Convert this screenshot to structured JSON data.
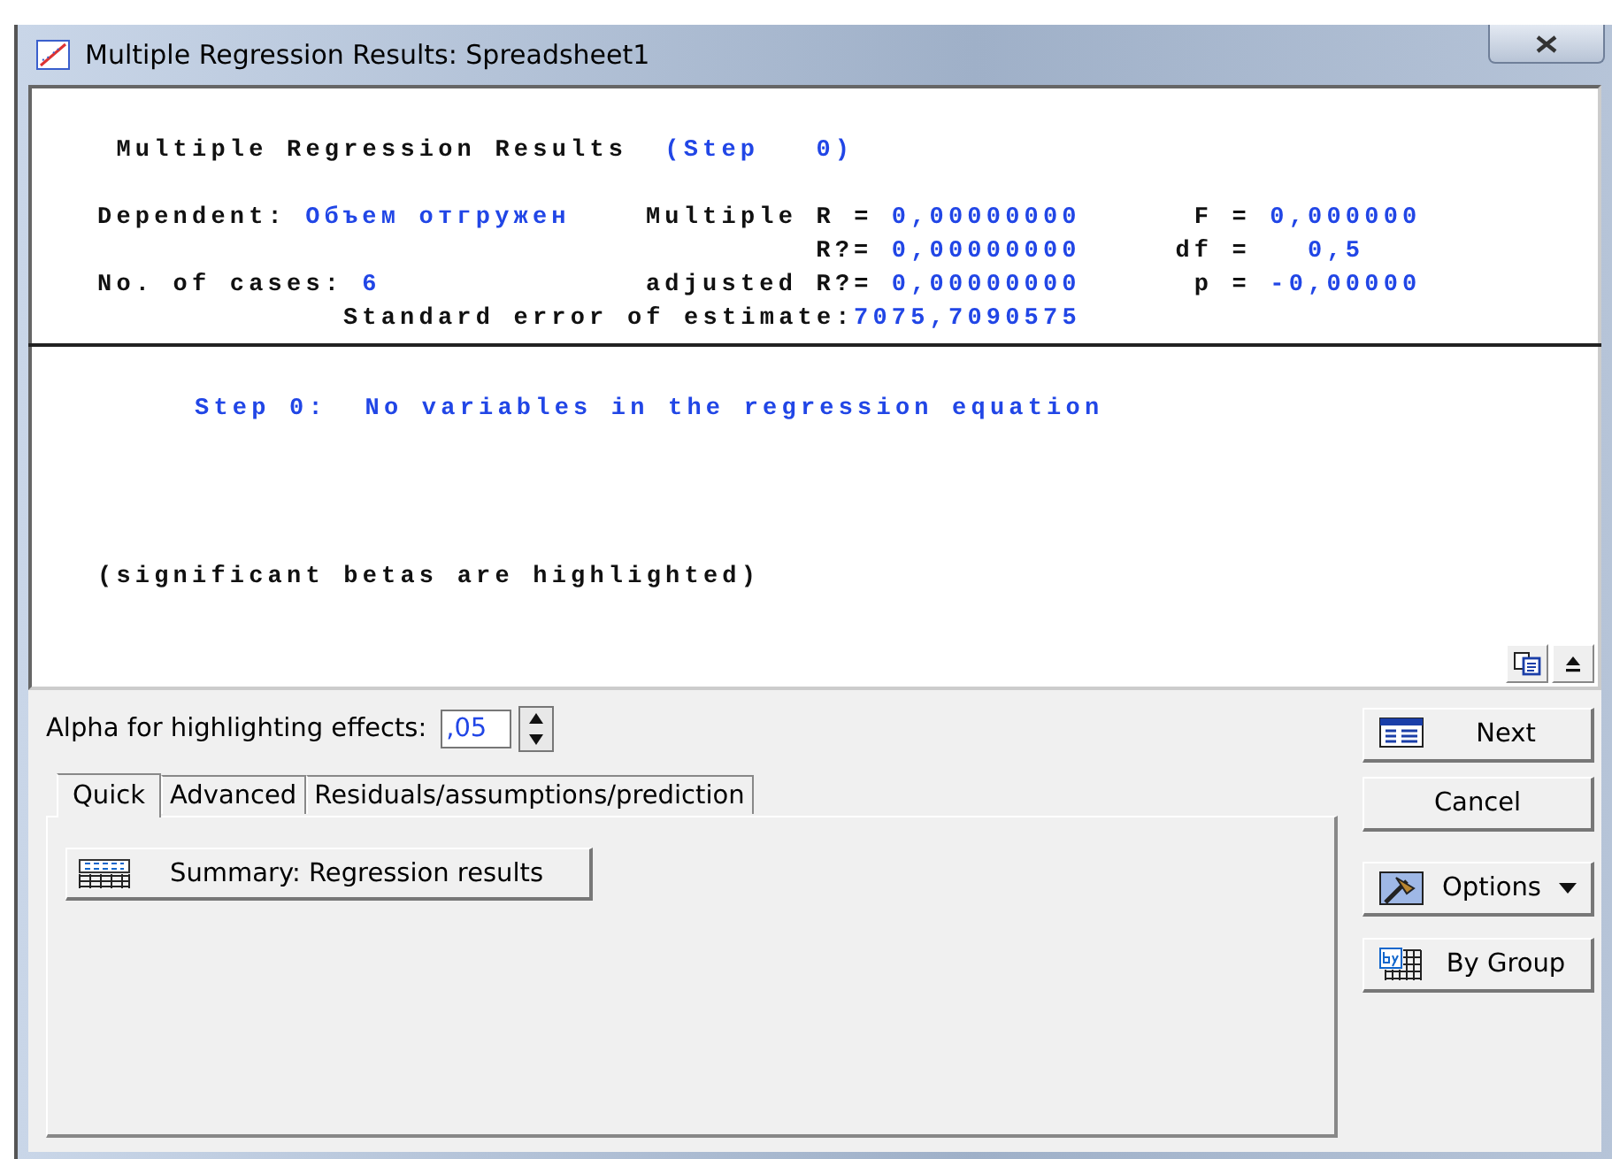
{
  "window": {
    "title": "Multiple Regression Results: Spreadsheet1"
  },
  "results": {
    "lines": [
      {
        "kind": "header",
        "segments": [
          {
            "text": "Multiple Regression Results",
            "highlight": false
          },
          {
            "text": "(Step   0)",
            "highlight": true
          }
        ]
      },
      {
        "kind": "dependent",
        "segments": [
          {
            "text": "Dependent:",
            "highlight": false
          },
          {
            "text": "Объем отгружен",
            "highlight": true
          },
          {
            "text": "Multiple R =",
            "highlight": false
          },
          {
            "text": "0,00000000",
            "highlight": true
          },
          {
            "text": "F =",
            "highlight": false
          },
          {
            "text": "0,000000",
            "highlight": true
          }
        ]
      },
      {
        "kind": "r2",
        "segments": [
          {
            "text": "R?=",
            "highlight": false
          },
          {
            "text": "0,00000000",
            "highlight": true
          },
          {
            "text": "df =",
            "highlight": false
          },
          {
            "text": "0,5",
            "highlight": true
          }
        ]
      },
      {
        "kind": "cases",
        "segments": [
          {
            "text": "No. of cases:",
            "highlight": false
          },
          {
            "text": "6",
            "highlight": true
          },
          {
            "text": "adjusted R?=",
            "highlight": false
          },
          {
            "text": "0,00000000",
            "highlight": true
          },
          {
            "text": "p =",
            "highlight": false
          },
          {
            "text": "-0,00000",
            "highlight": true
          }
        ]
      },
      {
        "kind": "stderr",
        "segments": [
          {
            "text": "Standard error of estimate:",
            "highlight": false
          },
          {
            "text": "7075,7090575",
            "highlight": true
          }
        ]
      }
    ],
    "step_note": "Step 0:  No variables in the regression equation",
    "footnote": "(significant betas are highlighted)"
  },
  "alpha": {
    "label": "Alpha for highlighting effects:",
    "value": ",05"
  },
  "tabs": [
    {
      "label": "Quick",
      "selected": true
    },
    {
      "label": "Advanced",
      "selected": false
    },
    {
      "label": "Residuals/assumptions/prediction",
      "selected": false
    }
  ],
  "tab_panel": {
    "buttons": [
      {
        "label": "Summary:  Regression results"
      }
    ]
  },
  "side_buttons": [
    {
      "label": "Next",
      "kind": "next"
    },
    {
      "label": "Cancel",
      "kind": "plain"
    },
    {
      "label": "Options",
      "kind": "options"
    },
    {
      "label": "By Group",
      "kind": "bygroup"
    }
  ]
}
